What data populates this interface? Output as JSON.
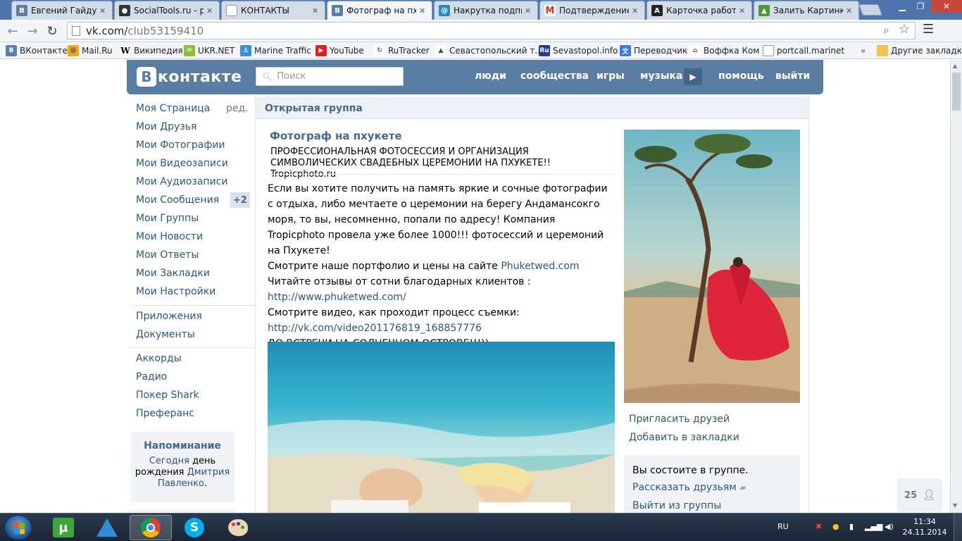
{
  "browser": {
    "tabs": [
      {
        "title": "Евгений Гайдуков",
        "icon": "vk-icon",
        "color": "#5b7fa6"
      },
      {
        "title": "SocialTools.ru - ре",
        "icon": "socialtools-icon",
        "color": "#333333"
      },
      {
        "title": "КОНТАКТЫ",
        "icon": "page-icon",
        "color": "#ffffff"
      },
      {
        "title": "Фотограф на пхук",
        "icon": "vk-icon",
        "color": "#5b7fa6"
      },
      {
        "title": "Накрутка подписч",
        "icon": "spiral-icon",
        "color": "#2a8ac0"
      },
      {
        "title": "Подтверждение р",
        "icon": "gmail-icon",
        "color": "#d93025"
      },
      {
        "title": "Карточка работы",
        "icon": "a-icon",
        "color": "#222222"
      },
      {
        "title": "Залить Картинку",
        "icon": "image-icon",
        "color": "#4a9a3a"
      }
    ],
    "url_host": "vk.com/",
    "url_path": "club53159410",
    "bookmarks": [
      {
        "label": "ВКонтакте",
        "icon": "vk-icon"
      },
      {
        "label": "Mail.Ru",
        "icon": "mailru-icon"
      },
      {
        "label": "Википедия",
        "icon": "wikipedia-icon"
      },
      {
        "label": "UKR.NET",
        "icon": "ukrnet-icon"
      },
      {
        "label": "Marine Traffic",
        "icon": "marinetraffic-icon"
      },
      {
        "label": "YouTube",
        "icon": "youtube-icon"
      },
      {
        "label": "RuTracker",
        "icon": "rutracker-icon"
      },
      {
        "label": "Севастопольский т...",
        "icon": "sevastopol-icon"
      },
      {
        "label": "Sevastopol.info",
        "icon": "ru-icon"
      },
      {
        "label": "Переводчик",
        "icon": "translate-icon"
      },
      {
        "label": "Воффка Ком",
        "icon": "house-icon"
      },
      {
        "label": "portcall.marinet",
        "icon": "page-icon"
      }
    ],
    "other_bookmarks": "Другие закладки"
  },
  "vk": {
    "logo": "ВКонтакте",
    "logo_letter": "В",
    "logo_word": "контакте",
    "search_placeholder": "Поиск",
    "nav": {
      "people": "люди",
      "communities": "сообщества",
      "games": "игры",
      "music": "музыка",
      "help": "помощь",
      "logout": "выйти"
    },
    "menu": {
      "main": [
        "Моя Страница",
        "Мои Друзья",
        "Мои Фотографии",
        "Мои Видеозаписи",
        "Мои Аудиозаписи",
        "Мои Сообщения",
        "Мои Группы",
        "Мои Новости",
        "Мои Ответы",
        "Мои Закладки",
        "Мои Настройки"
      ],
      "edit": "ред.",
      "messages_badge": "+2",
      "apps": [
        "Приложения",
        "Документы"
      ],
      "extra": [
        "Аккорды",
        "Радио",
        "Покер Shark",
        "Преферанс"
      ]
    },
    "reminder": {
      "title": "Напоминание",
      "today": "Сегодня",
      "text_mid": " день рождения ",
      "name": "Дмитрия Павленко",
      "end": "."
    },
    "group": {
      "type": "Открытая группа",
      "name": "Фотограф на пхукете",
      "status": "ПРОФЕССИОНАЛЬНАЯ ФОТОСЕССИЯ И ОРГАНИЗАЦИЯ СИМВОЛИЧЕСКИХ СВАДЕБНЫХ ЦЕРЕМОНИИ НА ПХУКЕТЕ!! Tropicphoto.ru",
      "desc_1": "Если вы хотите получить на память яркие и сочные фотографии с отдыха, либо мечтаете о церемонии на берегу Андамансокго моря, то вы, несомненно, попали по адресу! Компания Tropicphoto провела уже более 1000!!! фотосессий и церемоний на Пхукете!",
      "desc_2_text": "Смотрите наше портфолио и цены на сайте ",
      "desc_2_link": "Phuketwed.com",
      "desc_3": "Читайте отзывы от сотни благодарных клиентов :",
      "desc_4_link": "http://www.phuketwed.com/",
      "desc_5": "Смотрите видео, как проходит процесс съемки:",
      "desc_6_link": "http://vk.com/video201176819_168857776",
      "desc_7": "ДО ВСТРЕЧИ НА СОЛНЕЧНОМ ОСТРОВЕ!!!))"
    },
    "right": {
      "invite": "Пригласить друзей",
      "bookmark": "Добавить в закладки",
      "member_text": "Вы состоите в группе.",
      "tell_friends": "Рассказать друзьям",
      "leave": "Выйти из группы"
    },
    "likes": "25"
  },
  "taskbar": {
    "lang": "RU",
    "time": "11:34",
    "date": "24.11.2014"
  }
}
